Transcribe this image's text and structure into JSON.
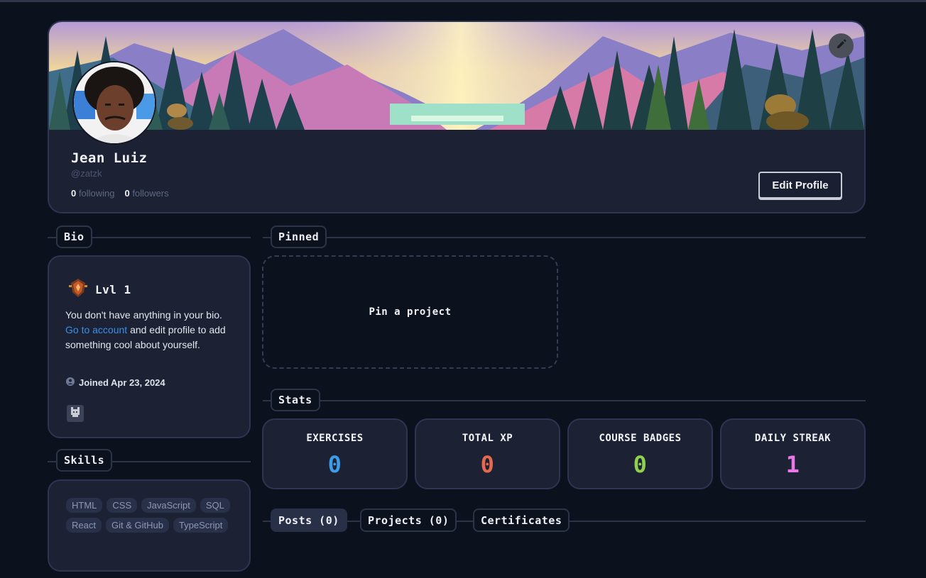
{
  "profile": {
    "name": "Jean Luiz",
    "handle": "@zatzk",
    "following_count": "0",
    "following_label": "following",
    "followers_count": "0",
    "followers_label": "followers",
    "edit_profile_label": "Edit Profile"
  },
  "sections": {
    "bio": "Bio",
    "skills": "Skills",
    "pinned": "Pinned",
    "stats": "Stats"
  },
  "bio": {
    "level": "Lvl 1",
    "text_before": "You don't have anything in your bio.",
    "link_text": "Go to account",
    "text_after": "and edit profile to add something cool about yourself.",
    "joined": "Joined Apr 23, 2024"
  },
  "skills": [
    "HTML",
    "CSS",
    "JavaScript",
    "SQL",
    "React",
    "Git & GitHub",
    "TypeScript"
  ],
  "pinned": {
    "placeholder": "Pin a project"
  },
  "stats": [
    {
      "label": "EXERCISES",
      "value": "0",
      "color": "#3d9be8"
    },
    {
      "label": "TOTAL XP",
      "value": "0",
      "color": "#e56a4e"
    },
    {
      "label": "COURSE BADGES",
      "value": "0",
      "color": "#8fd14f"
    },
    {
      "label": "DAILY STREAK",
      "value": "1",
      "color": "#e878e8"
    }
  ],
  "post_tabs": [
    {
      "label": "Posts (0)",
      "active": true
    },
    {
      "label": "Projects (0)",
      "active": false
    },
    {
      "label": "Certificates",
      "active": false
    }
  ],
  "colors": {
    "background": "#0c111e",
    "card": "#1c2234",
    "link": "#3b8fe6"
  }
}
